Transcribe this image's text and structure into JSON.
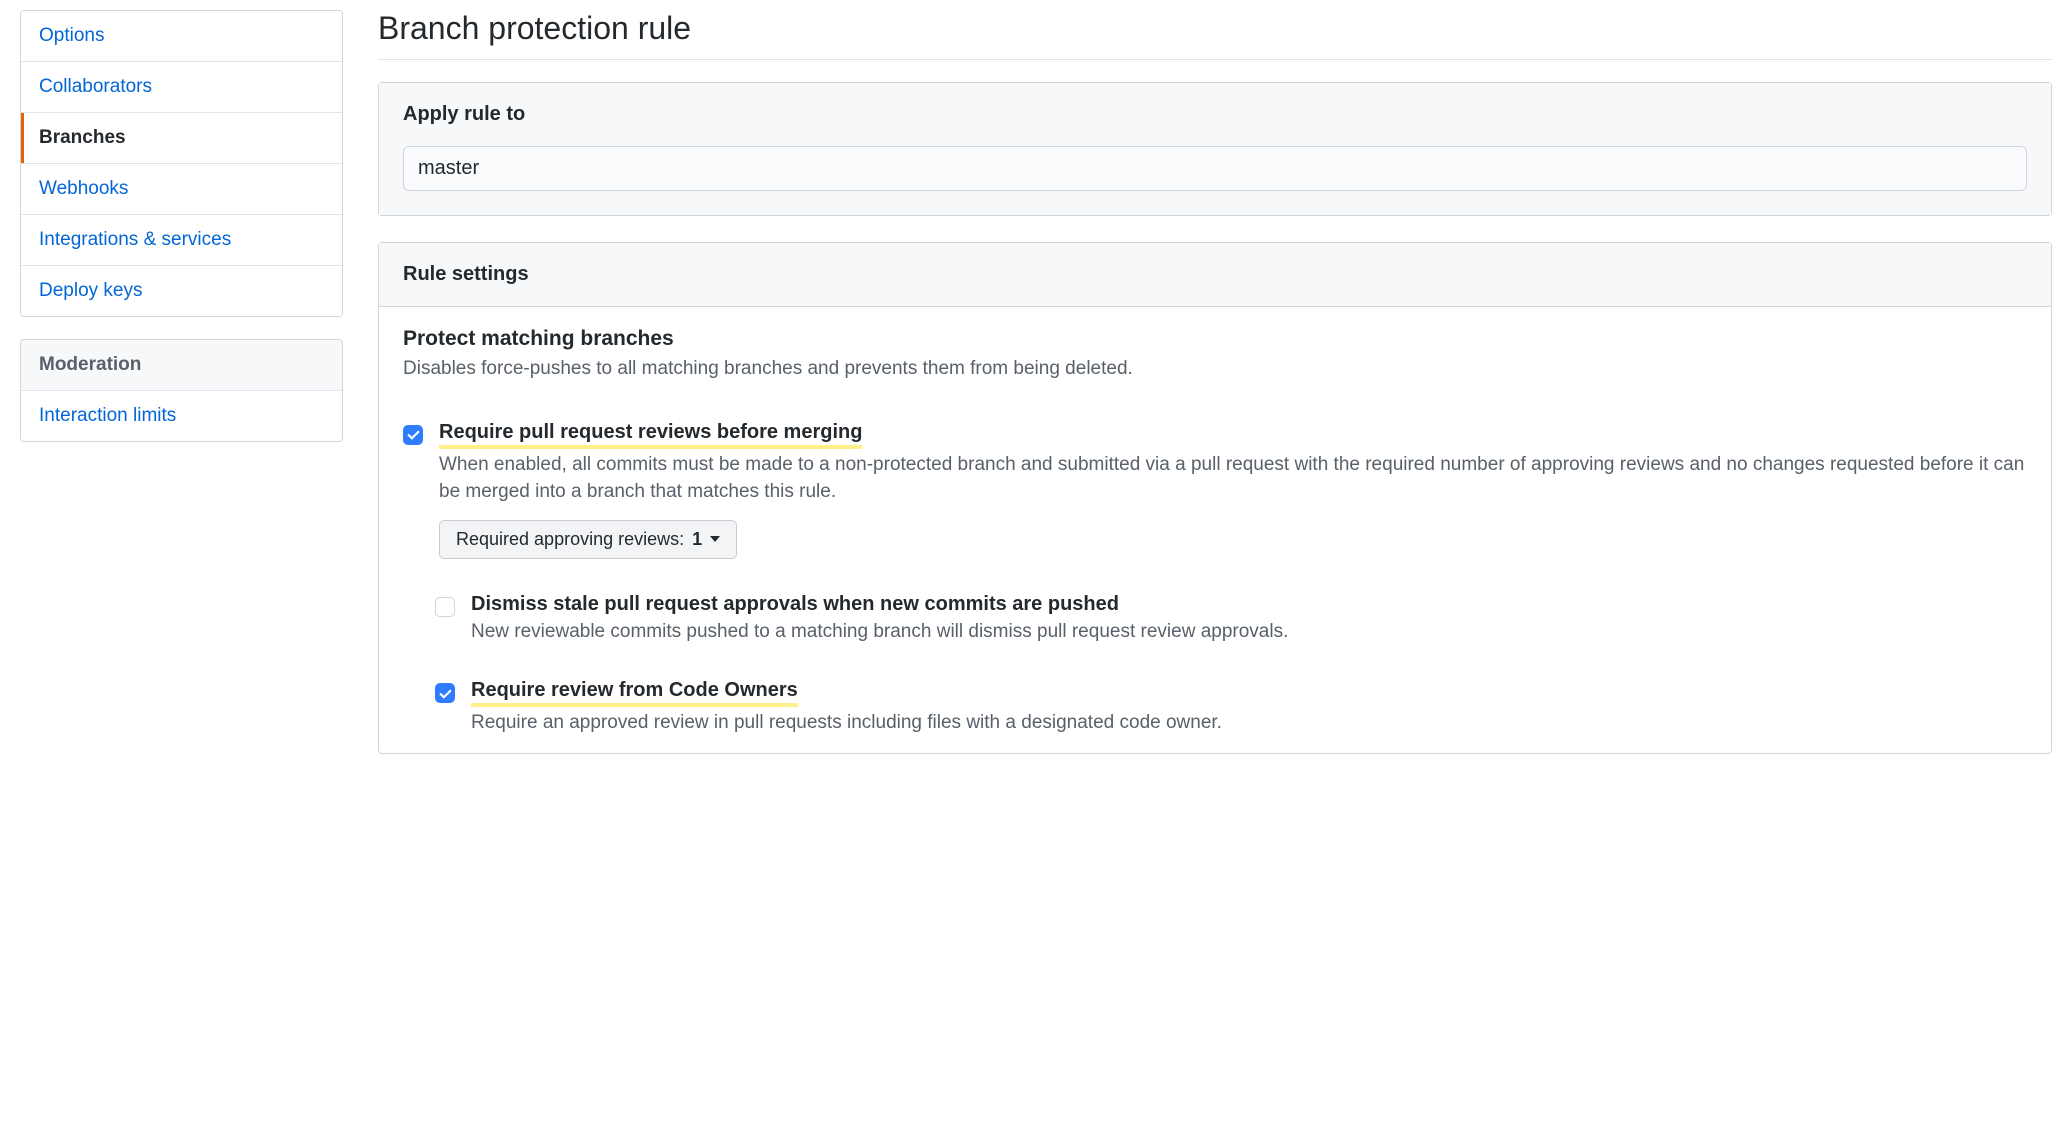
{
  "sidebar": {
    "group1": [
      {
        "label": "Options",
        "active": false
      },
      {
        "label": "Collaborators",
        "active": false
      },
      {
        "label": "Branches",
        "active": true
      },
      {
        "label": "Webhooks",
        "active": false
      },
      {
        "label": "Integrations & services",
        "active": false
      },
      {
        "label": "Deploy keys",
        "active": false
      }
    ],
    "moderation_header": "Moderation",
    "group2": [
      {
        "label": "Interaction limits",
        "active": false
      }
    ]
  },
  "page_title": "Branch protection rule",
  "apply_rule": {
    "header": "Apply rule to",
    "value": "master"
  },
  "rule_settings": {
    "header": "Rule settings",
    "protect_title": "Protect matching branches",
    "protect_desc": "Disables force-pushes to all matching branches and prevents them from being deleted.",
    "rules": {
      "require_reviews": {
        "checked": true,
        "highlight": true,
        "title": "Require pull request reviews before merging",
        "desc": "When enabled, all commits must be made to a non-protected branch and submitted via a pull request with the required number of approving reviews and no changes requested before it can be merged into a branch that matches this rule.",
        "approving_label": "Required approving reviews:",
        "approving_value": "1"
      },
      "dismiss_stale": {
        "checked": false,
        "highlight": false,
        "title": "Dismiss stale pull request approvals when new commits are pushed",
        "desc": "New reviewable commits pushed to a matching branch will dismiss pull request review approvals."
      },
      "code_owners": {
        "checked": true,
        "highlight": true,
        "title": "Require review from Code Owners",
        "desc": "Require an approved review in pull requests including files with a designated code owner."
      }
    }
  }
}
